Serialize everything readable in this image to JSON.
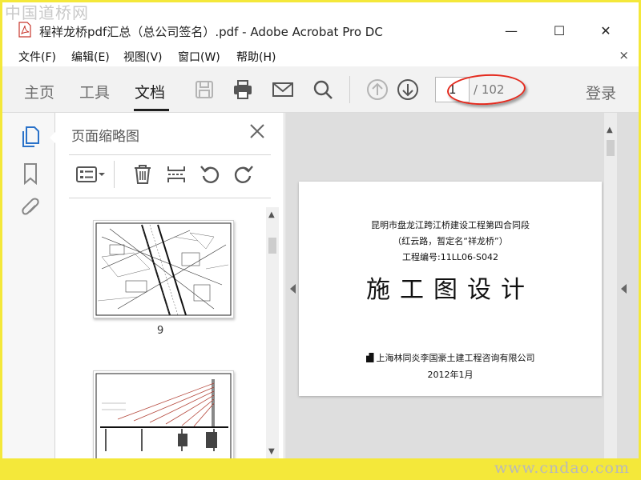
{
  "watermark": {
    "top": "中国道桥网",
    "bottom": "www.cndao.com"
  },
  "window": {
    "title": "程祥龙桥pdf汇总（总公司签名）.pdf - Adobe Acrobat Pro DC",
    "controls": {
      "minimize": "—",
      "maximize": "☐",
      "close": "✕"
    }
  },
  "menu": {
    "items": [
      "文件(F)",
      "编辑(E)",
      "视图(V)",
      "窗口(W)",
      "帮助(H)"
    ],
    "close": "×"
  },
  "toolbar": {
    "tabs": [
      "主页",
      "工具",
      "文档"
    ],
    "active_tab": "文档",
    "current_page": "1",
    "total_pages": "/ 102",
    "login": "登录"
  },
  "thumbnails_panel": {
    "title": "页面缩略图",
    "pages": [
      {
        "label": "9"
      },
      {
        "label": ""
      }
    ]
  },
  "document": {
    "line1": "昆明市盘龙江跨江桥建设工程第四合同段",
    "line2": "（红云路，暂定名“祥龙桥”）",
    "line3": "工程编号:11LL06-S042",
    "big_title": "施工图设计",
    "company": "上海林同炎李国豪土建工程咨询有限公司",
    "date": "2012年1月"
  },
  "colors": {
    "annotation": "#e42b1f",
    "active_icon": "#2a72c9",
    "toolbar_bg": "#f2f2f2",
    "frame": "#f4e83a"
  }
}
